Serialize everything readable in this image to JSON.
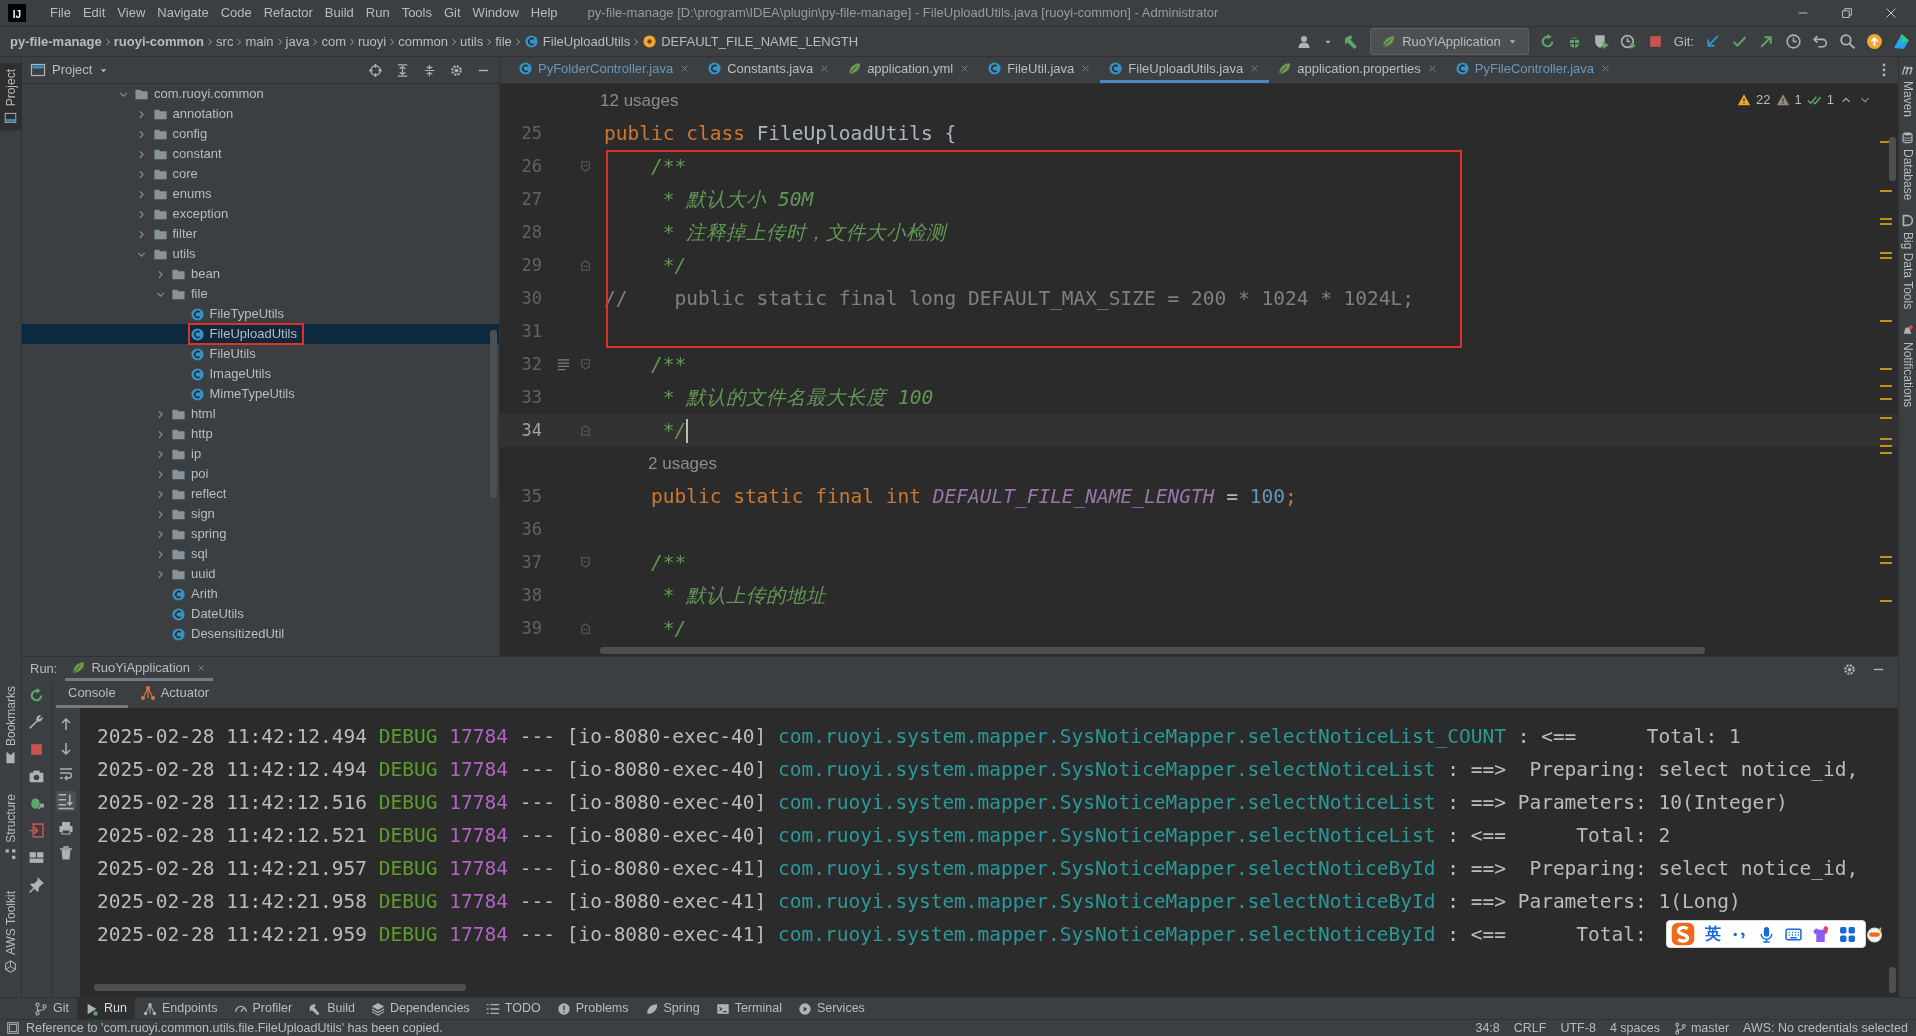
{
  "title_bar": {
    "logo_text": "IJ",
    "menus": [
      "File",
      "Edit",
      "View",
      "Navigate",
      "Code",
      "Refactor",
      "Build",
      "Run",
      "Tools",
      "Git",
      "Window",
      "Help"
    ],
    "title": "py-file-manage [D:\\program\\IDEA\\plugin\\py-file-manage] - FileUploadUtils.java [ruoyi-common] - Administrator"
  },
  "nav_bar": {
    "breadcrumbs": [
      {
        "label": "py-file-manage",
        "kind": "module"
      },
      {
        "label": "ruoyi-common",
        "kind": "module"
      },
      {
        "label": "src",
        "kind": "folder"
      },
      {
        "label": "main",
        "kind": "folder"
      },
      {
        "label": "java",
        "kind": "folder"
      },
      {
        "label": "com",
        "kind": "folder"
      },
      {
        "label": "ruoyi",
        "kind": "folder"
      },
      {
        "label": "common",
        "kind": "folder"
      },
      {
        "label": "utils",
        "kind": "folder"
      },
      {
        "label": "file",
        "kind": "folder"
      },
      {
        "label": "FileUploadUtils",
        "kind": "class"
      },
      {
        "label": "DEFAULT_FILE_NAME_LENGTH",
        "kind": "field"
      }
    ],
    "run_config": "RuoYiApplication",
    "git_label": "Git:"
  },
  "left_stripe": [
    {
      "label": "Project",
      "selected": true
    },
    {
      "label": "Bookmarks",
      "selected": false
    },
    {
      "label": "Structure",
      "selected": false
    },
    {
      "label": "AWS Toolkit",
      "selected": false
    }
  ],
  "right_stripe": [
    "Maven",
    "Database",
    "Big Data Tools",
    "Notifications"
  ],
  "project_panel": {
    "title": "Project",
    "tree": [
      {
        "name": "com.ruoyi.common",
        "kind": "package",
        "expanded": true,
        "selected": false,
        "children": [
          {
            "name": "annotation",
            "kind": "package",
            "expanded": false,
            "selected": false
          },
          {
            "name": "config",
            "kind": "package",
            "expanded": false,
            "selected": false
          },
          {
            "name": "constant",
            "kind": "package",
            "expanded": false,
            "selected": false
          },
          {
            "name": "core",
            "kind": "package",
            "expanded": false,
            "selected": false
          },
          {
            "name": "enums",
            "kind": "package",
            "expanded": false,
            "selected": false
          },
          {
            "name": "exception",
            "kind": "package",
            "expanded": false,
            "selected": false
          },
          {
            "name": "filter",
            "kind": "package",
            "expanded": false,
            "selected": false
          },
          {
            "name": "utils",
            "kind": "package",
            "expanded": true,
            "selected": false,
            "children": [
              {
                "name": "bean",
                "kind": "package",
                "expanded": false,
                "selected": false
              },
              {
                "name": "file",
                "kind": "package",
                "expanded": true,
                "selected": false,
                "children": [
                  {
                    "name": "FileTypeUtils",
                    "kind": "class",
                    "selected": false
                  },
                  {
                    "name": "FileUploadUtils",
                    "kind": "class",
                    "selected": true,
                    "outlined": true
                  },
                  {
                    "name": "FileUtils",
                    "kind": "class",
                    "selected": false
                  },
                  {
                    "name": "ImageUtils",
                    "kind": "class",
                    "selected": false
                  },
                  {
                    "name": "MimeTypeUtils",
                    "kind": "class",
                    "selected": false
                  }
                ]
              },
              {
                "name": "html",
                "kind": "package",
                "expanded": false,
                "selected": false
              },
              {
                "name": "http",
                "kind": "package",
                "expanded": false,
                "selected": false
              },
              {
                "name": "ip",
                "kind": "package",
                "expanded": false,
                "selected": false
              },
              {
                "name": "poi",
                "kind": "package",
                "expanded": false,
                "selected": false
              },
              {
                "name": "reflect",
                "kind": "package",
                "expanded": false,
                "selected": false
              },
              {
                "name": "sign",
                "kind": "package",
                "expanded": false,
                "selected": false
              },
              {
                "name": "spring",
                "kind": "package",
                "expanded": false,
                "selected": false
              },
              {
                "name": "sql",
                "kind": "package",
                "expanded": false,
                "selected": false
              },
              {
                "name": "uuid",
                "kind": "package",
                "expanded": false,
                "selected": false
              },
              {
                "name": "Arith",
                "kind": "class",
                "selected": false
              },
              {
                "name": "DateUtils",
                "kind": "class",
                "selected": false
              },
              {
                "name": "DesensitizedUtil",
                "kind": "class",
                "selected": false
              }
            ]
          }
        ]
      }
    ]
  },
  "editor": {
    "tabs": [
      {
        "label": "PyFolderController.java",
        "kind": "class",
        "color": "#6897bb",
        "selected": false
      },
      {
        "label": "Constants.java",
        "kind": "class",
        "color": "#bbbbbb",
        "selected": false
      },
      {
        "label": "application.yml",
        "kind": "config",
        "color": "#bbbbbb",
        "selected": false
      },
      {
        "label": "FileUtil.java",
        "kind": "class",
        "color": "#bbbbbb",
        "selected": false
      },
      {
        "label": "FileUploadUtils.java",
        "kind": "class",
        "color": "#bbbbbb",
        "selected": true
      },
      {
        "label": "application.properties",
        "kind": "config",
        "color": "#bbbbbb",
        "selected": false
      },
      {
        "label": "PyFileController.java",
        "kind": "class",
        "color": "#6897bb",
        "selected": false
      }
    ],
    "inspections": {
      "warnings": "22",
      "weak_warnings": "1",
      "passed": "1"
    },
    "highlight_box": true,
    "lines": [
      {
        "kind": "hint",
        "text": "12 usages"
      },
      {
        "kind": "code",
        "number": "25",
        "current": false,
        "segments": [
          {
            "text": "public class ",
            "kind": "keyword"
          },
          {
            "text": "FileUploadUtils {",
            "kind": "text"
          }
        ]
      },
      {
        "kind": "code",
        "number": "26",
        "current": false,
        "fold_start": true,
        "segments": [
          {
            "text": "    /**",
            "kind": "doc"
          }
        ]
      },
      {
        "kind": "code",
        "number": "27",
        "current": false,
        "segments": [
          {
            "text": "     * 默认大小 50M",
            "kind": "doc"
          }
        ]
      },
      {
        "kind": "code",
        "number": "28",
        "current": false,
        "segments": [
          {
            "text": "     * 注释掉上传时，文件大小检测",
            "kind": "doc"
          }
        ]
      },
      {
        "kind": "code",
        "number": "29",
        "current": false,
        "fold_end": true,
        "segments": [
          {
            "text": "     */",
            "kind": "doc"
          }
        ]
      },
      {
        "kind": "code",
        "number": "30",
        "current": false,
        "segments": [
          {
            "text": "//    public static final long DEFAULT_MAX_SIZE = 200 * 1024 * 1024L;",
            "kind": "comment"
          }
        ]
      },
      {
        "kind": "code",
        "number": "31",
        "current": false
      },
      {
        "kind": "code",
        "number": "32",
        "current": false,
        "fold_start": true,
        "doc_toggle": true,
        "segments": [
          {
            "text": "    /**",
            "kind": "doc"
          }
        ]
      },
      {
        "kind": "code",
        "number": "33",
        "current": false,
        "segments": [
          {
            "text": "     * 默认的文件名最大长度 100",
            "kind": "doc"
          }
        ]
      },
      {
        "kind": "code",
        "number": "34",
        "current": true,
        "fold_end": true,
        "segments": [
          {
            "text": "     */",
            "kind": "doc"
          }
        ]
      },
      {
        "kind": "memberhint",
        "text": "2 usages"
      },
      {
        "kind": "code",
        "number": "35",
        "current": false,
        "segments": [
          {
            "text": "    public static final int ",
            "kind": "keyword"
          },
          {
            "text": "DEFAULT_FILE_NAME_LENGTH",
            "kind": "field"
          },
          {
            "text": " = ",
            "kind": "text"
          },
          {
            "text": "100",
            "kind": "number"
          },
          {
            "text": ";",
            "kind": "keyword"
          }
        ]
      },
      {
        "kind": "code",
        "number": "36",
        "current": false
      },
      {
        "kind": "code",
        "number": "37",
        "current": false,
        "fold_start": true,
        "segments": [
          {
            "text": "    /**",
            "kind": "doc"
          }
        ]
      },
      {
        "kind": "code",
        "number": "38",
        "current": false,
        "segments": [
          {
            "text": "     * 默认上传的地址",
            "kind": "doc"
          }
        ]
      },
      {
        "kind": "code",
        "number": "39",
        "current": false,
        "fold_end": true,
        "segments": [
          {
            "text": "     */",
            "kind": "doc"
          }
        ]
      }
    ]
  },
  "run_panel": {
    "label": "Run:",
    "config_tab": "RuoYiApplication",
    "tabs": [
      {
        "label": "Console",
        "selected": true
      },
      {
        "label": "Actuator",
        "selected": false
      }
    ],
    "console": [
      {
        "time": "2025-02-28 11:42:12.494",
        "level": "DEBUG",
        "pid": "17784",
        "sep": "---",
        "thread": "[io-8080-exec-40]",
        "logger": "com.ruoyi.system.mapper.SysNoticeMapper.selectNoticeList_COUNT",
        "message": ": <==      Total: 1"
      },
      {
        "time": "2025-02-28 11:42:12.494",
        "level": "DEBUG",
        "pid": "17784",
        "sep": "---",
        "thread": "[io-8080-exec-40]",
        "logger": "com.ruoyi.system.mapper.SysNoticeMapper.selectNoticeList",
        "message": ": ==>  Preparing: select notice_id,"
      },
      {
        "time": "2025-02-28 11:42:12.516",
        "level": "DEBUG",
        "pid": "17784",
        "sep": "---",
        "thread": "[io-8080-exec-40]",
        "logger": "com.ruoyi.system.mapper.SysNoticeMapper.selectNoticeList",
        "message": ": ==> Parameters: 10(Integer)"
      },
      {
        "time": "2025-02-28 11:42:12.521",
        "level": "DEBUG",
        "pid": "17784",
        "sep": "---",
        "thread": "[io-8080-exec-40]",
        "logger": "com.ruoyi.system.mapper.SysNoticeMapper.selectNoticeList",
        "message": ": <==      Total: 2"
      },
      {
        "time": "2025-02-28 11:42:21.957",
        "level": "DEBUG",
        "pid": "17784",
        "sep": "---",
        "thread": "[io-8080-exec-41]",
        "logger": "com.ruoyi.system.mapper.SysNoticeMapper.selectNoticeById",
        "message": ": ==>  Preparing: select notice_id,"
      },
      {
        "time": "2025-02-28 11:42:21.958",
        "level": "DEBUG",
        "pid": "17784",
        "sep": "---",
        "thread": "[io-8080-exec-41]",
        "logger": "com.ruoyi.system.mapper.SysNoticeMapper.selectNoticeById",
        "message": ": ==> Parameters: 1(Long)"
      },
      {
        "time": "2025-02-28 11:42:21.959",
        "level": "DEBUG",
        "pid": "17784",
        "sep": "---",
        "thread": "[io-8080-exec-41]",
        "logger": "com.ruoyi.system.mapper.SysNoticeMapper.selectNoticeById",
        "message": ": <==      Total:"
      }
    ]
  },
  "tool_windows": [
    {
      "label": "Git",
      "selected": false
    },
    {
      "label": "Run",
      "selected": true
    },
    {
      "label": "Endpoints",
      "selected": false
    },
    {
      "label": "Profiler",
      "selected": false
    },
    {
      "label": "Build",
      "selected": false
    },
    {
      "label": "Dependencies",
      "selected": false
    },
    {
      "label": "TODO",
      "selected": false
    },
    {
      "label": "Problems",
      "selected": false
    },
    {
      "label": "Spring",
      "selected": false
    },
    {
      "label": "Terminal",
      "selected": false
    },
    {
      "label": "Services",
      "selected": false
    }
  ],
  "status_bar": {
    "message": "Reference to 'com.ruoyi.common.utils.file.FileUploadUtils' has been copied.",
    "items": [
      {
        "label": "34:8",
        "kind": "position"
      },
      {
        "label": "CRLF",
        "kind": "separator"
      },
      {
        "label": "UTF-8",
        "kind": "encoding"
      },
      {
        "label": "4 spaces",
        "kind": "indent"
      },
      {
        "label": "master",
        "kind": "branch"
      },
      {
        "label": "AWS: No credentials selected",
        "kind": "account"
      }
    ]
  },
  "input_method": {
    "mode": "英"
  }
}
